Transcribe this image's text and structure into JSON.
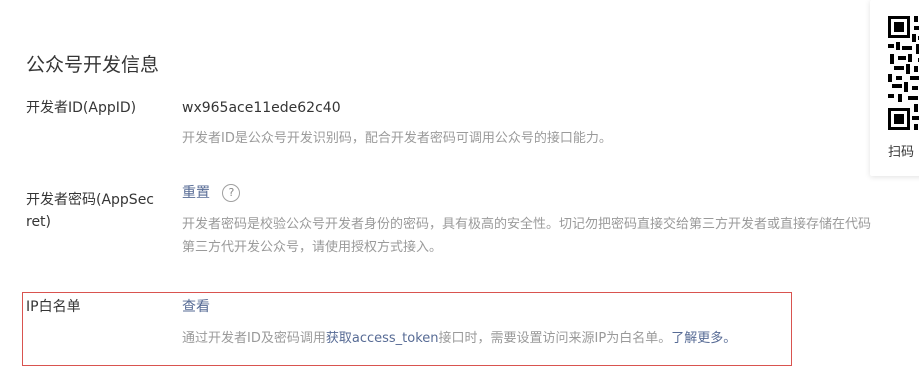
{
  "page": {
    "title": "公众号开发信息"
  },
  "app_id": {
    "label": "开发者ID(AppID)",
    "value": "wx965ace11ede62c40",
    "description": "开发者ID是公众号开发识别码，配合开发者密码可调用公众号的接口能力。"
  },
  "app_secret": {
    "label_line1": "开发者密码(AppSec",
    "label_line2": "ret)",
    "action": "重置",
    "help_icon": "question-mark",
    "description_line1": "开发者密码是校验公众号开发者身份的密码，具有极高的安全性。切记勿把密码直接交给第三方开发者或直接存储在代码",
    "description_line2": "第三方代开发公众号，请使用授权方式接入。"
  },
  "ip_whitelist": {
    "label": "IP白名单",
    "action": "查看",
    "description_pre": "通过开发者ID及密码调用",
    "description_link": "获取access_token",
    "description_post": "接口时，需要设置访问来源IP为白名单。",
    "learn_more": "了解更多。",
    "highlight_color": "#d9534f"
  },
  "qr_panel": {
    "caption": "扫码",
    "icon": "qr-code"
  },
  "colors": {
    "link": "#576b95",
    "muted": "#9a9a9a",
    "text": "#353535"
  }
}
